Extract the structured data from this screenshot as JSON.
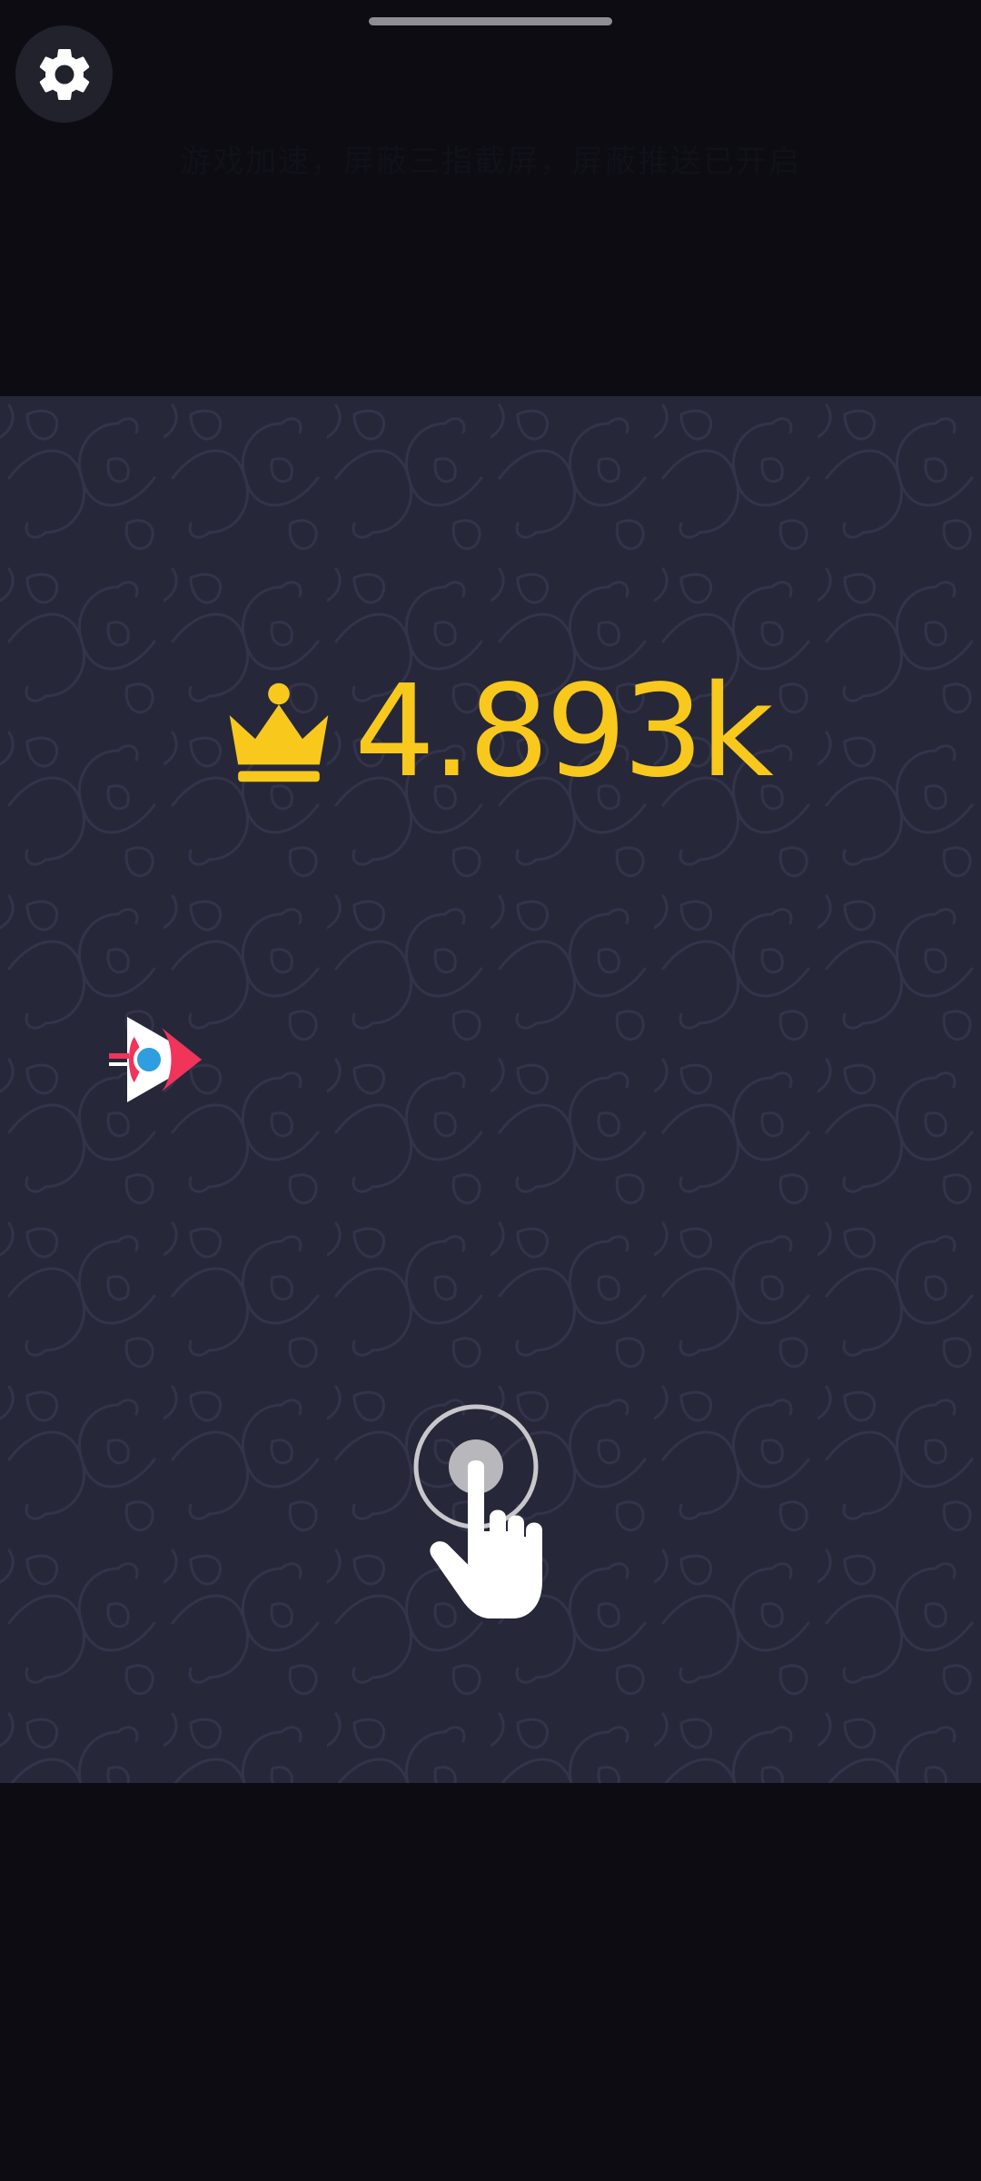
{
  "status_bar": {
    "gesture_bar": "home-indicator"
  },
  "toolbar": {
    "settings_icon": "gear-icon"
  },
  "notice": {
    "text": "游戏加速，屏蔽三指截屏，屏蔽推送已开启"
  },
  "game": {
    "score": {
      "icon": "crown-icon",
      "value": "4.893k"
    },
    "player_ship": "rocket-ship-icon",
    "tap_hint": "tap-hand-icon"
  },
  "colors": {
    "background": "#0c0c12",
    "game_area": "#27273a",
    "score": "#f8c91c",
    "ship_red": "#f0345a",
    "ship_blue": "#2e9ee0",
    "ship_white": "#ffffff"
  }
}
